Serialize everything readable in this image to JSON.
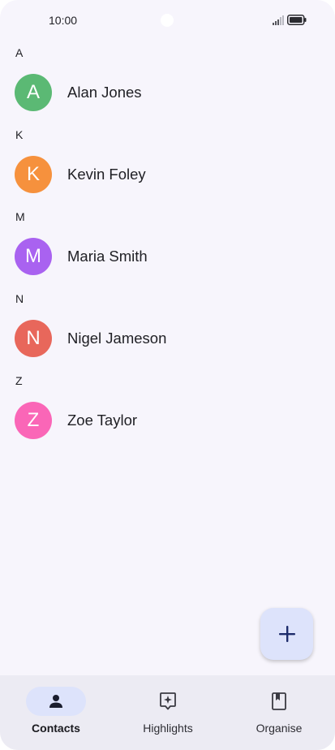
{
  "status_bar": {
    "time": "10:00",
    "icons": [
      "signal-icon",
      "battery-icon"
    ]
  },
  "contacts": {
    "sections": [
      {
        "letter": "A",
        "contact": {
          "initial": "A",
          "name": "Alan Jones",
          "color": "#5bb974"
        }
      },
      {
        "letter": "K",
        "contact": {
          "initial": "K",
          "name": "Kevin Foley",
          "color": "#f6913d"
        }
      },
      {
        "letter": "M",
        "contact": {
          "initial": "M",
          "name": "Maria Smith",
          "color": "#a962f0"
        }
      },
      {
        "letter": "N",
        "contact": {
          "initial": "N",
          "name": "Nigel Jameson",
          "color": "#e8675b"
        }
      },
      {
        "letter": "Z",
        "contact": {
          "initial": "Z",
          "name": "Zoe Taylor",
          "color": "#fa66b7"
        }
      }
    ]
  },
  "fab": {
    "icon": "add-icon",
    "color": "#1d2c6b"
  },
  "bottom_nav": {
    "items": [
      {
        "label": "Contacts",
        "icon": "person-icon",
        "active": true
      },
      {
        "label": "Highlights",
        "icon": "highlights-icon",
        "active": false
      },
      {
        "label": "Organise",
        "icon": "bookmark-icon",
        "active": false
      }
    ]
  },
  "colors": {
    "background": "#f7f5fc",
    "nav_background": "#ecebf3",
    "accent_container": "#dde3fb",
    "text": "#1f1f24"
  }
}
